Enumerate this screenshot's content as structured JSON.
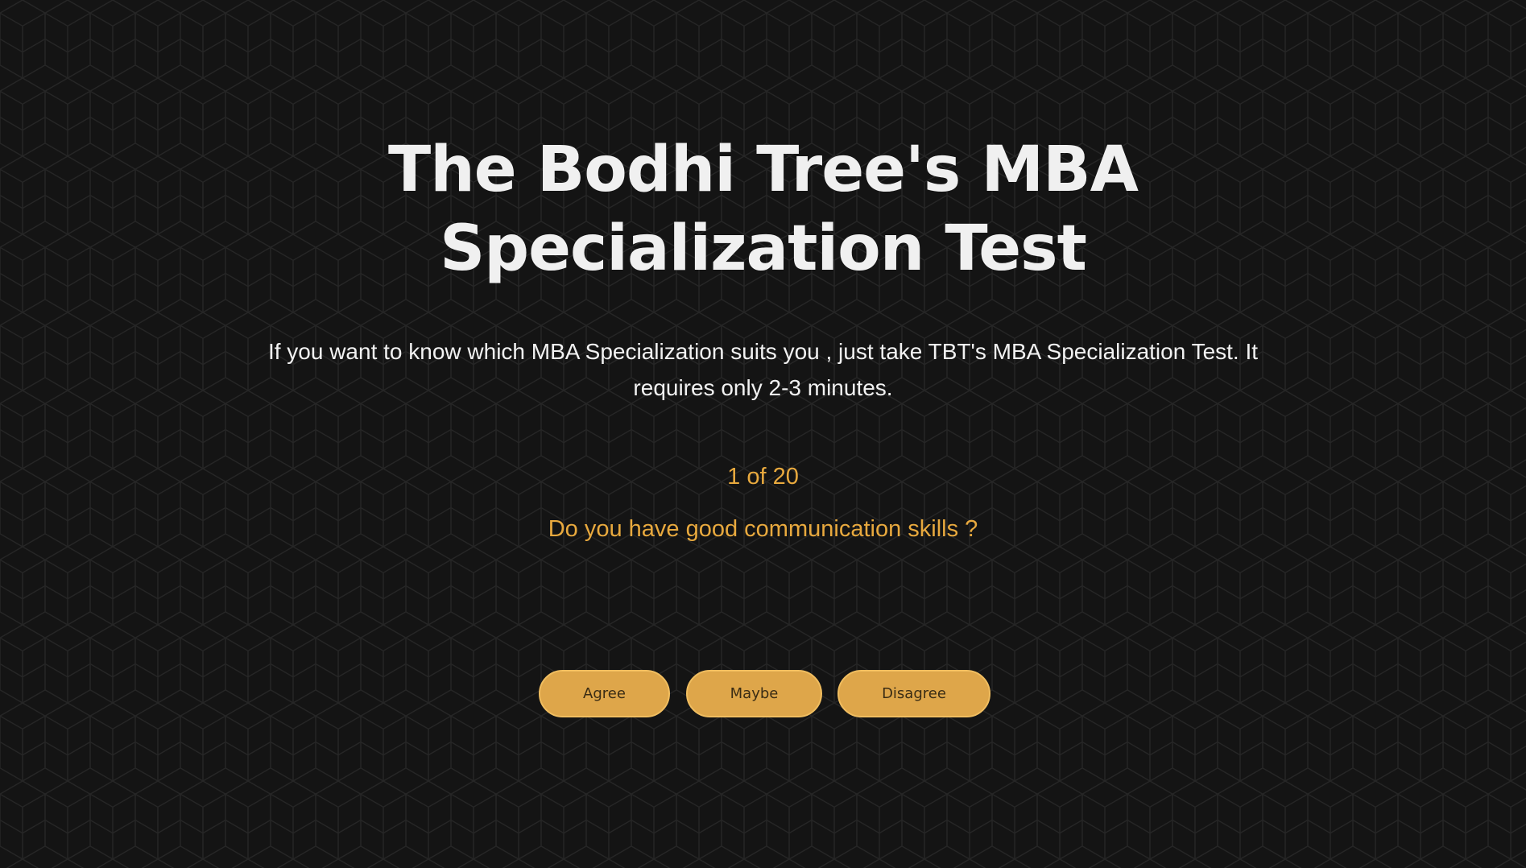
{
  "quiz": {
    "title_line1": "The Bodhi Tree's MBA",
    "title_line2": "Specialization Test",
    "description": "If you want to know which MBA Specialization suits you , just take TBT's MBA Specialization Test. It requires only 2-3 minutes.",
    "progress_text": "1 of 20",
    "question": "Do you have good communication skills ?",
    "answers": {
      "agree": "Agree",
      "maybe": "Maybe",
      "disagree": "Disagree"
    }
  },
  "colors": {
    "background": "#141414",
    "pattern_stroke": "#262626",
    "accent": "#e8a93e",
    "button_fill": "#dea64a",
    "button_text": "#3a2c14",
    "heading": "#f0f0f0"
  }
}
